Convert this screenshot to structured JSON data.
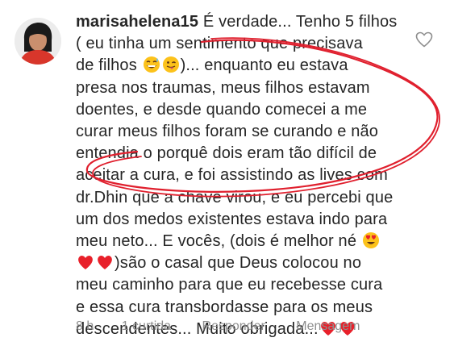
{
  "comment": {
    "username": "marisahelena15",
    "lines": [
      " É verdade... Tenho 5 filhos",
      "( eu tinha um sentimento que precisava",
      "de filhos",
      ")... enquanto eu estava",
      "presa nos traumas, meus filhos estavam",
      "doentes, e desde quando comecei a me",
      "curar meus filhos foram se curando e não",
      "entendia o porquê dois eram tão difícil de",
      "aceitar a cura, e foi assistindo as lives com",
      "dr.Dhin que a chave virou, e eu percebi que",
      "um dos medos existentes estava indo para",
      "meu neto... E vocês, (dois é melhor né",
      ")são o casal que Deus colocou no",
      "meu caminho para que eu recebesse cura",
      "e essa cura transbordasse para os meus",
      "descendentes... Muito obrigada..."
    ],
    "emojis": {
      "line3": [
        "grinning-sweat-emoji",
        "winking-tongue-emoji"
      ],
      "line12": [
        "heart-eyes-emoji"
      ],
      "line13": [
        "red-heart-emoji",
        "red-heart-emoji"
      ],
      "line16": [
        "red-heart-emoji",
        "red-heart-emoji"
      ]
    }
  },
  "actions": {
    "time": "8 h",
    "likes": "1 curtida",
    "reply": "Responder",
    "message": "Mensagem"
  },
  "icons": {
    "like": "heart-outline-icon",
    "annotation": "red-hand-drawn-ellipse"
  },
  "colors": {
    "annotation": "#e0202e",
    "text": "#262626",
    "muted": "#8e8e8e",
    "heart": "#e8202a"
  }
}
